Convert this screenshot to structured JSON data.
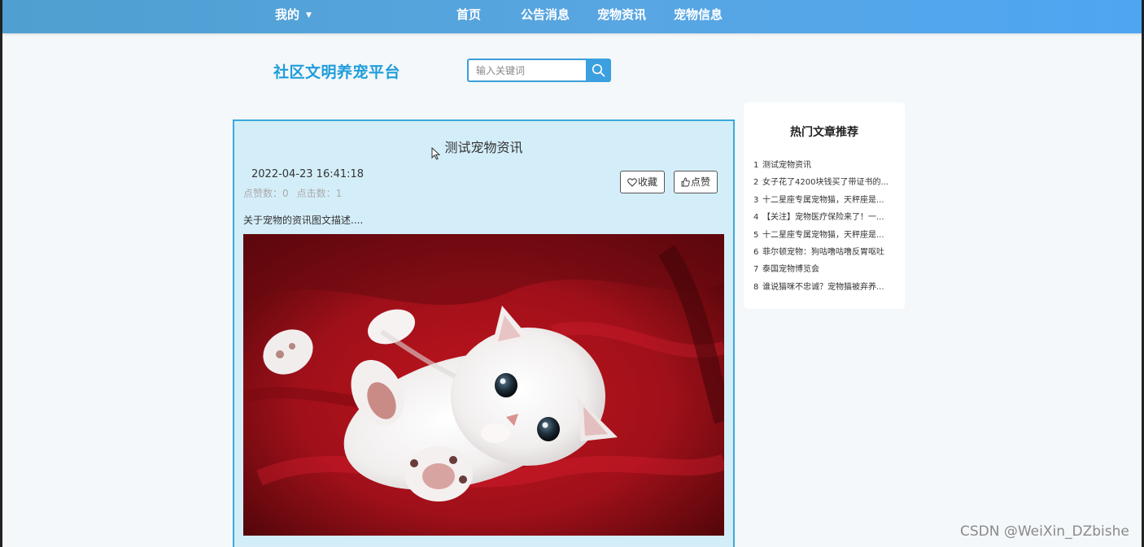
{
  "nav": {
    "me_label": "我的",
    "home_label": "首页",
    "notice_label": "公告消息",
    "news_label": "宠物资讯",
    "info_label": "宠物信息"
  },
  "header": {
    "site_title": "社区文明养宠平台",
    "search_placeholder": "输入关键词"
  },
  "article": {
    "title": "测试宠物资讯",
    "date": "2022-04-23 16:41:18",
    "likes_label": "点赞数：0",
    "clicks_label": "点击数：1",
    "favorite_label": "收藏",
    "like_label": "点赞",
    "description": "关于宠物的资讯图文描述...."
  },
  "sidebar": {
    "title": "热门文章推荐",
    "items": [
      {
        "num": "1",
        "text": "测试宠物资讯"
      },
      {
        "num": "2",
        "text": "女子花了4200块钱买了带证书的..."
      },
      {
        "num": "3",
        "text": "十二星座专属宠物猫，天秤座是..."
      },
      {
        "num": "4",
        "text": "【关注】宠物医疗保险来了！一..."
      },
      {
        "num": "5",
        "text": "十二星座专属宠物猫，天秤座是..."
      },
      {
        "num": "6",
        "text": "菲尔顿宠物：狗咕噜咕噜反胃呕吐"
      },
      {
        "num": "7",
        "text": "泰国宠物博览会"
      },
      {
        "num": "8",
        "text": "谁说猫咪不忠诚？宠物猫被弃养..."
      }
    ]
  },
  "watermark": "CSDN @WeiXin_DZbishe",
  "colors": {
    "nav_bg": "#58a6e2",
    "accent": "#1f9ddb",
    "card_bg": "#d4eef9",
    "card_border": "#3aa9df"
  },
  "icons": {
    "search": "search-icon",
    "favorite": "heart-icon",
    "like": "thumbs-up-icon",
    "dropdown": "caret-down-icon",
    "cursor": "mouse-pointer-icon"
  }
}
